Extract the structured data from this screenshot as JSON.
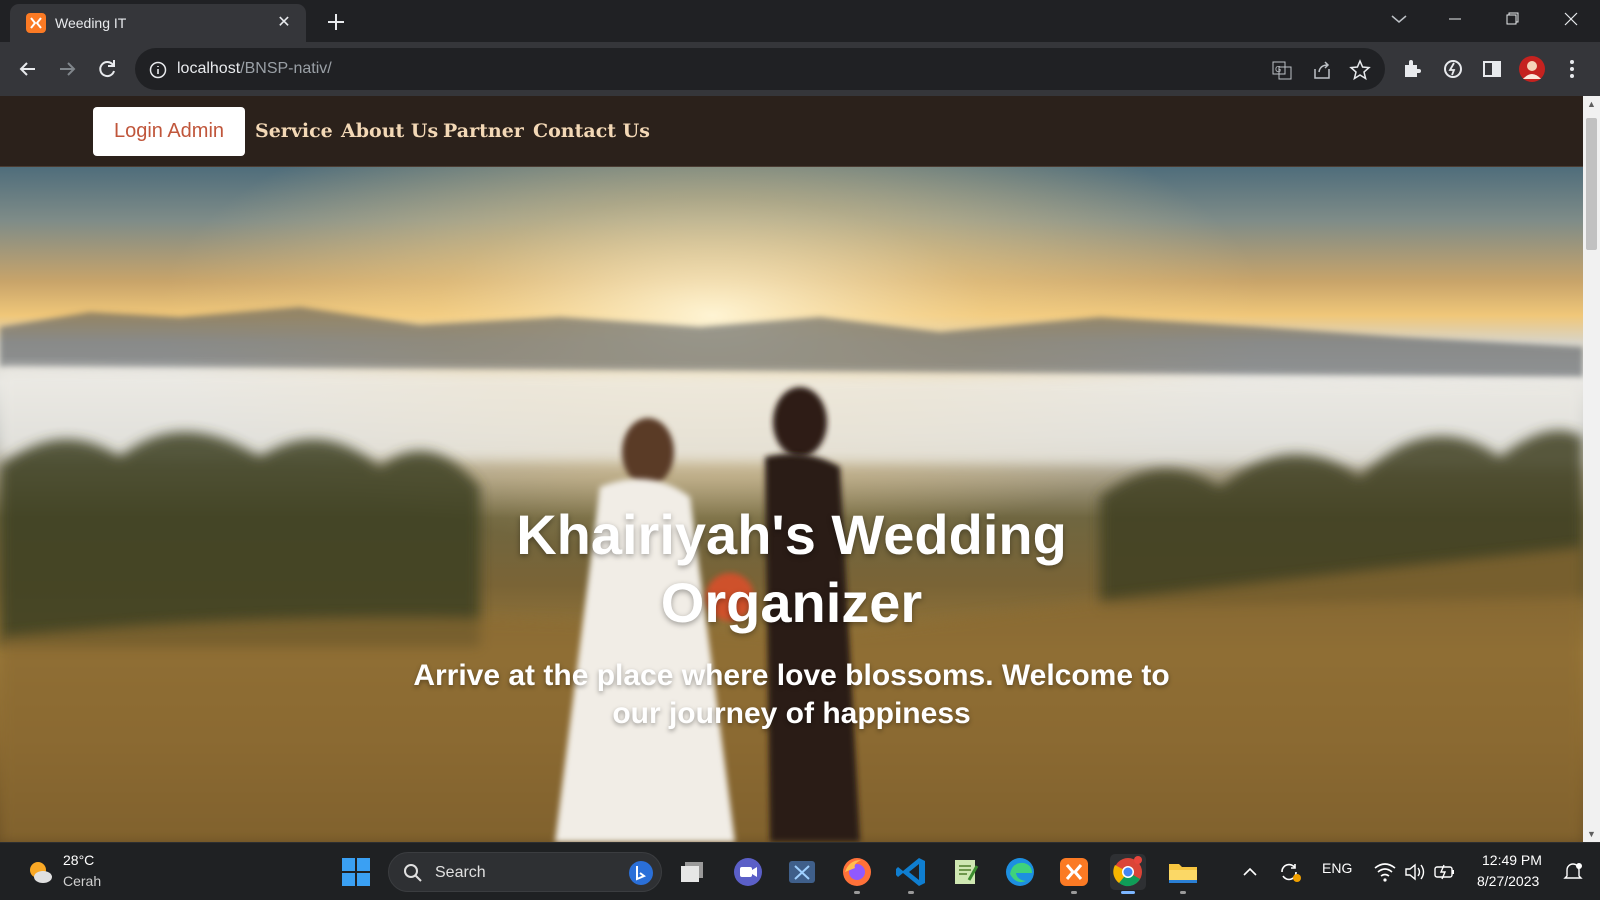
{
  "browser": {
    "tab_title": "Weeding IT",
    "url_host": "localhost",
    "url_path": "/BNSP-nativ/"
  },
  "site": {
    "login_label": "Login Admin",
    "nav": [
      "Service",
      "About Us",
      "Partner",
      "Contact Us"
    ],
    "hero_title_line1": "Khairiyah's Wedding",
    "hero_title_line2": "Organizer",
    "hero_subtitle_line1": "Arrive at the place where love blossoms. Welcome to",
    "hero_subtitle_line2": "our journey of happiness"
  },
  "taskbar": {
    "weather_temp": "28°C",
    "weather_desc": "Cerah",
    "search_label": "Search",
    "language": "ENG",
    "time": "12:49 PM",
    "date": "8/27/2023",
    "apps": [
      "task-view",
      "meet",
      "snipping",
      "firefox",
      "vscode",
      "notepad",
      "edge",
      "xampp",
      "chrome",
      "file-explorer"
    ]
  },
  "colors": {
    "accent_nav_bg": "#2b211b",
    "nav_link": "#f3d8b6",
    "login_text": "#c0563b",
    "xampp_orange": "#fb7a24"
  }
}
